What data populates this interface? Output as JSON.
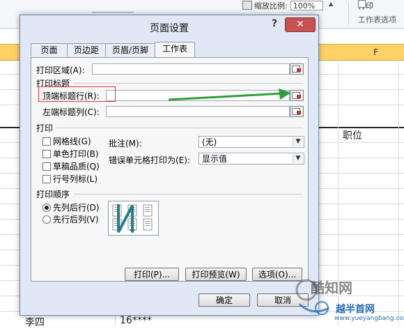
{
  "excel": {
    "zoom_label": "缩放比例:",
    "zoom_value": "100%",
    "print_label": "打印",
    "group_label": "工作表选项",
    "column_f": "F",
    "cell_job": "职位",
    "cell_name": "李四",
    "cell_phone": "16****"
  },
  "dialog": {
    "title": "页面设置",
    "help": "?",
    "close": "✕",
    "tabs": [
      {
        "label": "页面"
      },
      {
        "label": "页边距"
      },
      {
        "label": "页眉/页脚"
      },
      {
        "label": "工作表"
      }
    ],
    "print_area_label": "打印区域(A):",
    "print_titles_label": "打印标题",
    "top_rows_label": "顶端标题行(R):",
    "left_cols_label": "左端标题列(C):",
    "print_section_label": "打印",
    "checkboxes": [
      {
        "label": "网格线(G)"
      },
      {
        "label": "单色打印(B)"
      },
      {
        "label": "草稿品质(Q)"
      },
      {
        "label": "行号列标(L)"
      }
    ],
    "comments_label": "批注(M):",
    "comments_value": "(无)",
    "errors_label": "错误单元格打印为(E):",
    "errors_value": "显示值",
    "order_label": "打印顺序",
    "order_options": [
      {
        "label": "先列后行(D)",
        "selected": true
      },
      {
        "label": "先行后列(V)",
        "selected": false
      }
    ],
    "print_button": "打印(P)...",
    "preview_button": "打印预览(W)",
    "options_button": "选项(O)...",
    "ok_button": "确定",
    "cancel_button": "取消"
  },
  "watermark": {
    "name": "酷知网",
    "brand": "越半首网",
    "url": "www.yueyangbang.com"
  },
  "colors": {
    "header_band": "#ffd166",
    "close_red": "#c75050",
    "dialog_bg": "#dfe8f4",
    "annotation_red": "#e53030",
    "annotation_green": "#2e9e3a"
  }
}
